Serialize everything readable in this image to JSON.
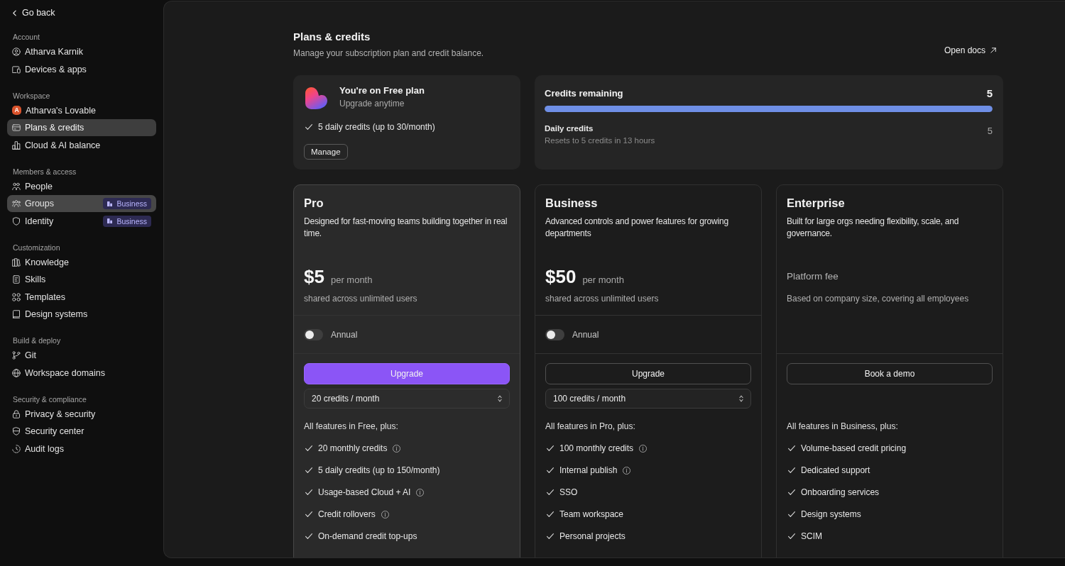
{
  "sidebar": {
    "back": {
      "label": "Go back"
    },
    "sections": [
      {
        "heading": "Account",
        "items": [
          {
            "label": "Atharva Karnik",
            "selected": false,
            "hovered": false
          },
          {
            "label": "Devices & apps",
            "selected": false,
            "hovered": false
          }
        ]
      },
      {
        "heading": "Workspace",
        "items": [
          {
            "label": "Atharva's Lovable",
            "avatar": "A",
            "selected": false,
            "hovered": false
          },
          {
            "label": "Plans & credits",
            "selected": true,
            "hovered": false
          },
          {
            "label": "Cloud & AI balance",
            "selected": false,
            "hovered": false
          }
        ]
      },
      {
        "heading": "Members & access",
        "items": [
          {
            "label": "People",
            "selected": false,
            "hovered": false
          },
          {
            "label": "Groups",
            "badge": "Business",
            "selected": false,
            "hovered": true
          },
          {
            "label": "Identity",
            "badge": "Business",
            "selected": false,
            "hovered": false
          }
        ]
      },
      {
        "heading": "Customization",
        "items": [
          {
            "label": "Knowledge",
            "selected": false,
            "hovered": false
          },
          {
            "label": "Skills",
            "selected": false,
            "hovered": false
          },
          {
            "label": "Templates",
            "selected": false,
            "hovered": false
          },
          {
            "label": "Design systems",
            "selected": false,
            "hovered": false
          }
        ]
      },
      {
        "heading": "Build & deploy",
        "items": [
          {
            "label": "Git",
            "selected": false,
            "hovered": false
          },
          {
            "label": "Workspace domains",
            "selected": false,
            "hovered": false
          }
        ]
      },
      {
        "heading": "Security & compliance",
        "items": [
          {
            "label": "Privacy & security",
            "selected": false,
            "hovered": false
          },
          {
            "label": "Security center",
            "selected": false,
            "hovered": false
          },
          {
            "label": "Audit logs",
            "selected": false,
            "hovered": false
          }
        ]
      }
    ]
  },
  "page": {
    "title": "Plans & credits",
    "subtitle": "Manage your subscription plan and credit balance.",
    "docs_link": "Open docs"
  },
  "current_plan": {
    "title": "You're on Free plan",
    "subtitle": "Upgrade anytime",
    "feature": "5 daily credits (up to 30/month)",
    "button": "Manage"
  },
  "credits": {
    "title": "Credits remaining",
    "balance": "5",
    "level": 1,
    "daily_label": "Daily credits",
    "daily_note": "Resets to 5 credits in 13 hours",
    "daily_value": "5"
  },
  "plans": [
    {
      "name": "Pro",
      "highlighted": true,
      "description": "Designed for fast-moving teams building together in real time.",
      "price": "$5",
      "period": "per month",
      "price_note": "shared across unlimited users",
      "annual": {
        "label": "Annual",
        "on": false
      },
      "button": {
        "label": "Upgrade",
        "kind": "primary"
      },
      "credits_select": {
        "value": "20 credits / month"
      },
      "features_heading": "All features in Free, plus:",
      "features": [
        {
          "label": "20 monthly credits",
          "info": true
        },
        {
          "label": "5 daily credits (up to 150/month)",
          "info": false
        },
        {
          "label": "Usage-based Cloud + AI",
          "info": true
        },
        {
          "label": "Credit rollovers",
          "info": true
        },
        {
          "label": "On-demand credit top-ups",
          "info": false
        }
      ]
    },
    {
      "name": "Business",
      "highlighted": false,
      "description": "Advanced controls and power features for growing departments",
      "price": "$50",
      "period": "per month",
      "price_note": "shared across unlimited users",
      "annual": {
        "label": "Annual",
        "on": false
      },
      "button": {
        "label": "Upgrade",
        "kind": "outline"
      },
      "credits_select": {
        "value": "100 credits / month"
      },
      "features_heading": "All features in Pro, plus:",
      "features": [
        {
          "label": "100 monthly credits",
          "info": true
        },
        {
          "label": "Internal publish",
          "info": true
        },
        {
          "label": "SSO",
          "info": false
        },
        {
          "label": "Team workspace",
          "info": false
        },
        {
          "label": "Personal projects",
          "info": false
        }
      ]
    },
    {
      "name": "Enterprise",
      "highlighted": false,
      "description": "Built for large orgs needing flexibility, scale, and governance.",
      "fee_label": "Platform fee",
      "price_note": "Based on company size, covering all employees",
      "button": {
        "label": "Book a demo",
        "kind": "outline"
      },
      "features_heading": "All features in Business, plus:",
      "features": [
        {
          "label": "Volume-based credit pricing",
          "info": false
        },
        {
          "label": "Dedicated support",
          "info": false
        },
        {
          "label": "Onboarding services",
          "info": false
        },
        {
          "label": "Design systems",
          "info": false
        },
        {
          "label": "SCIM",
          "info": false
        }
      ]
    }
  ]
}
